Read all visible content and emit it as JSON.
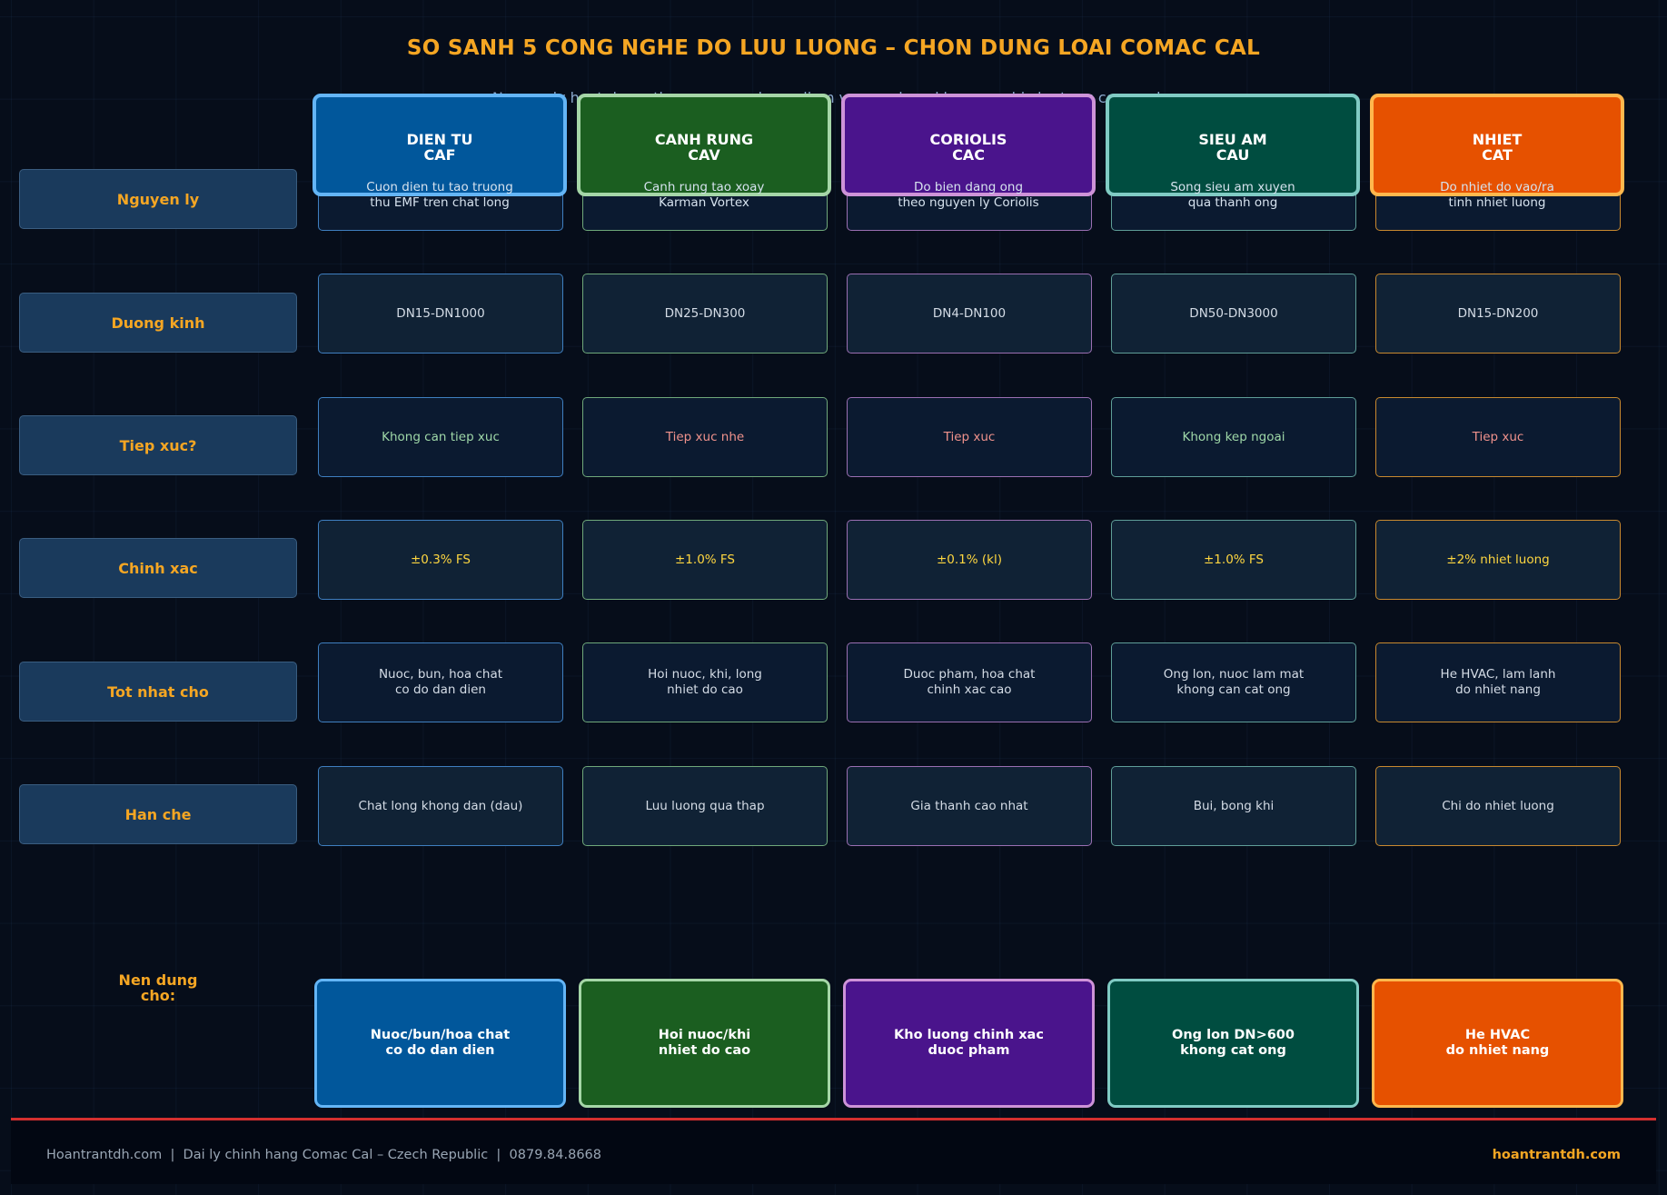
{
  "title": "SO SANH 5 CONG NGHE DO LUU LUONG – CHON DUNG LOAI COMAC CAL",
  "subtitle": "Nguyen ly hoat dong, thong so, uu nhuoc diem va ung dung khuyen nghi cho tung cong nghe",
  "colors": {
    "accent": "#f5a623",
    "caf": "#01579b",
    "caf_border": "#64b5f6",
    "cav": "#1b5e20",
    "cav_border": "#a5d6a7",
    "cac": "#4a148c",
    "cac_border": "#ce93d8",
    "cau": "#004d40",
    "cau_border": "#80cbc4",
    "cat": "#e65100",
    "cat_border": "#ffb74d"
  },
  "technologies": [
    {
      "name": "DIEN TU\nCAF",
      "desc": "Cuon dien tu tao truong\nthu EMF tren chat long",
      "recommend": "Nuoc/bun/hoa chat\nco do dan dien"
    },
    {
      "name": "CANH RUNG\nCAV",
      "desc": "Canh rung tao xoay\nKarman Vortex",
      "recommend": "Hoi nuoc/khi\nnhiet do cao"
    },
    {
      "name": "CORIOLIS\nCAC",
      "desc": "Do bien dang ong\ntheo nguyen ly Coriolis",
      "recommend": "Kho luong chinh xac\nduoc pham"
    },
    {
      "name": "SIEU AM\nCAU",
      "desc": "Song sieu am xuyen\nqua thanh ong",
      "recommend": "Ong lon DN>600\nkhong cat ong"
    },
    {
      "name": "NHIET\nCAT",
      "desc": "Do nhiet do vao/ra\ntinh nhiet luong",
      "recommend": "He HVAC\ndo nhiet nang"
    }
  ],
  "row_labels": [
    "Nguyen ly",
    "Duong kinh",
    "Tiep xuc?",
    "Chinh xac",
    "Tot nhat cho",
    "Han che"
  ],
  "rows": {
    "duong_kinh": [
      "DN15-DN1000",
      "DN25-DN300",
      "DN4-DN100",
      "DN50-DN3000",
      "DN15-DN200"
    ],
    "tiep_xuc": [
      "Khong can tiep xuc",
      "Tiep xuc nhe",
      "Tiep xuc",
      "Khong kep ngoai",
      "Tiep xuc"
    ],
    "chinh_xac": [
      "±0.3% FS",
      "±1.0% FS",
      "±0.1% (kl)",
      "±1.0% FS",
      "±2% nhiet luong"
    ],
    "tot_nhat_cho": [
      "Nuoc, bun, hoa chat\nco do dan dien",
      "Hoi nuoc, khi, long\nnhiet do cao",
      "Duoc pham, hoa chat\nchinh xac cao",
      "Ong lon, nuoc lam mat\nkhong can cat ong",
      "He HVAC, lam lanh\ndo nhiet nang"
    ],
    "han_che": [
      "Chat long khong dan (dau)",
      "Luu luong qua thap",
      "Gia thanh cao nhat",
      "Bui, bong khi",
      "Chi do nhiet luong"
    ]
  },
  "recommend_label": "Nen dung\ncho:",
  "footer": {
    "left": "Hoantrantdh.com  |  Dai ly chinh hang Comac Cal – Czech Republic  |  0879.84.8668",
    "right": "hoantrantdh.com"
  }
}
